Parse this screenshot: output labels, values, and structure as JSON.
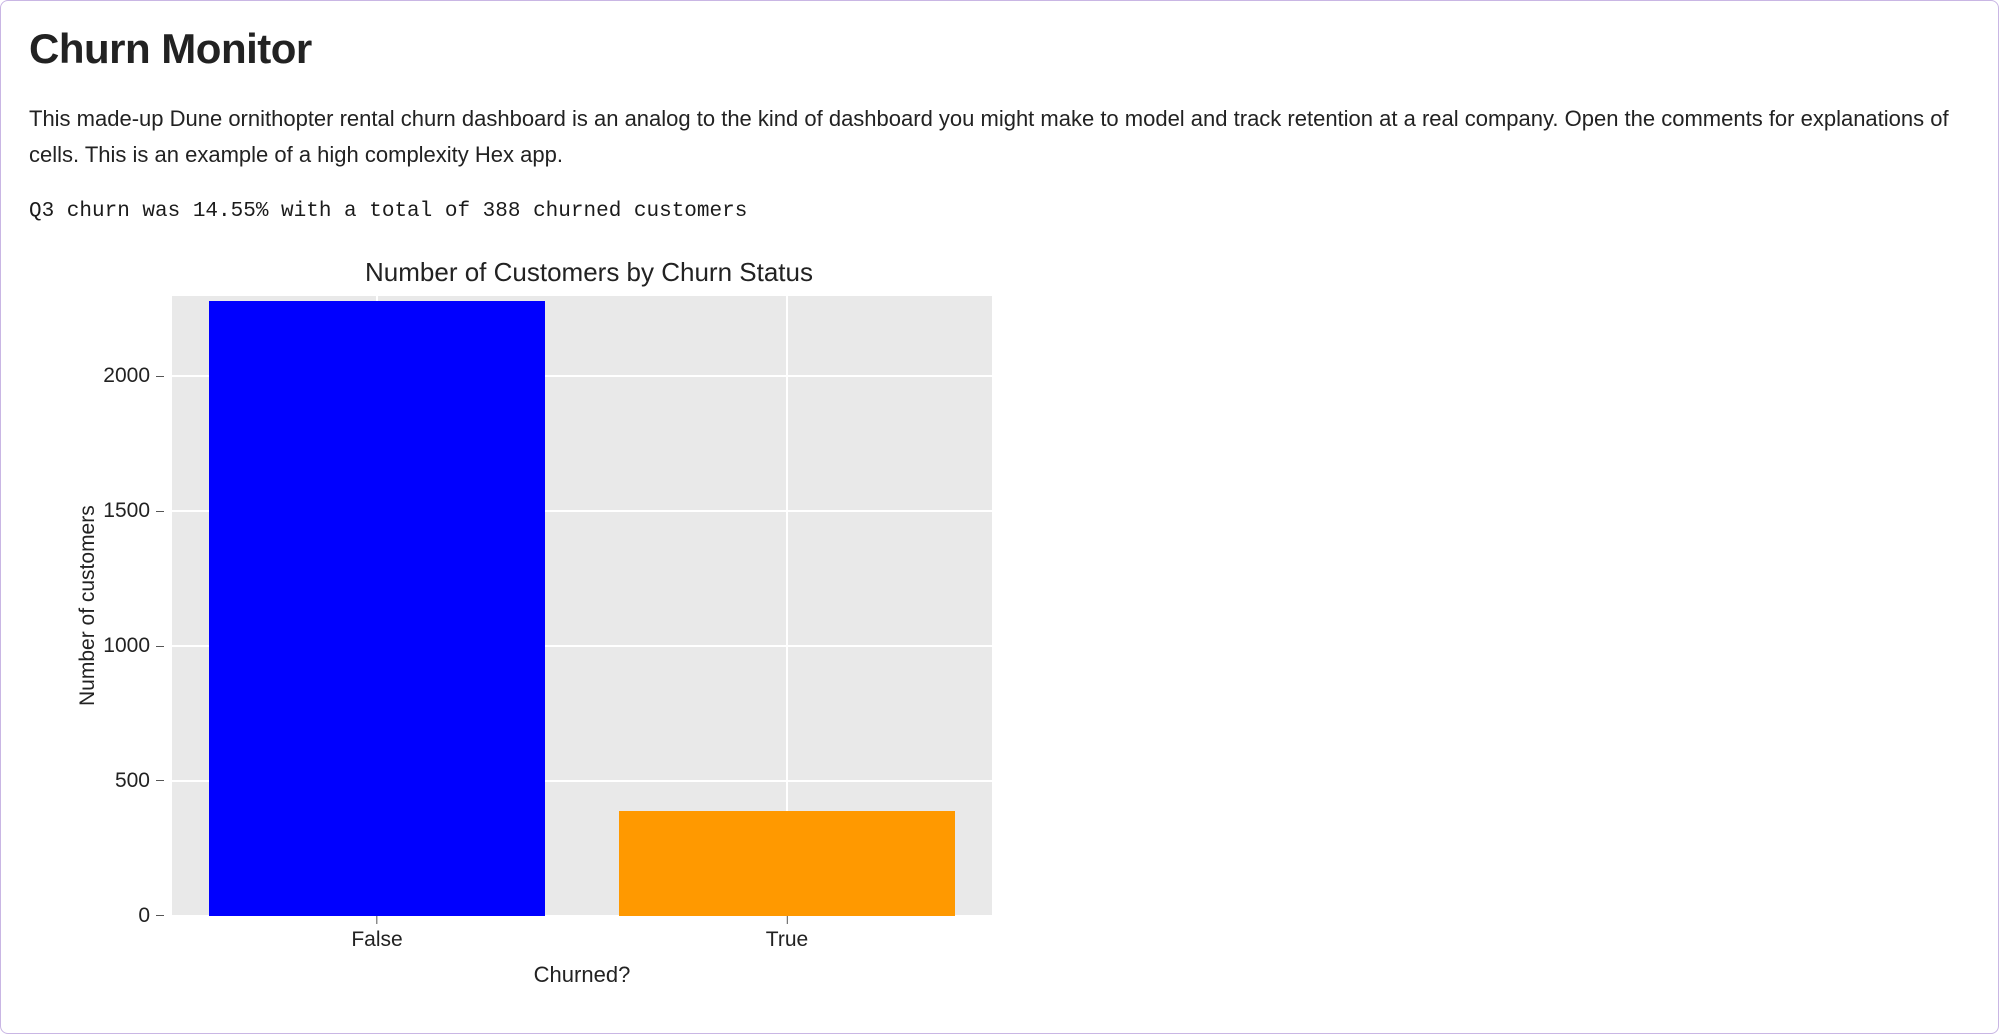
{
  "header": {
    "title": "Churn Monitor"
  },
  "description": "This made-up Dune ornithopter rental churn dashboard is an analog to the kind of dashboard you might make to model and track retention at a real company. Open the comments for explanations of cells. This is an example of a high complexity Hex app.",
  "summary": "Q3 churn was 14.55% with a total of 388 churned customers",
  "chart_data": {
    "type": "bar",
    "title": "Number of Customers by Churn Status",
    "xlabel": "Churned?",
    "ylabel": "Number of customers",
    "categories": [
      "False",
      "True"
    ],
    "values": [
      2280,
      388
    ],
    "ylim": [
      0,
      2300
    ],
    "yticks": [
      0,
      500,
      1000,
      1500,
      2000
    ],
    "colors": [
      "#0000ff",
      "#ff9900"
    ]
  }
}
